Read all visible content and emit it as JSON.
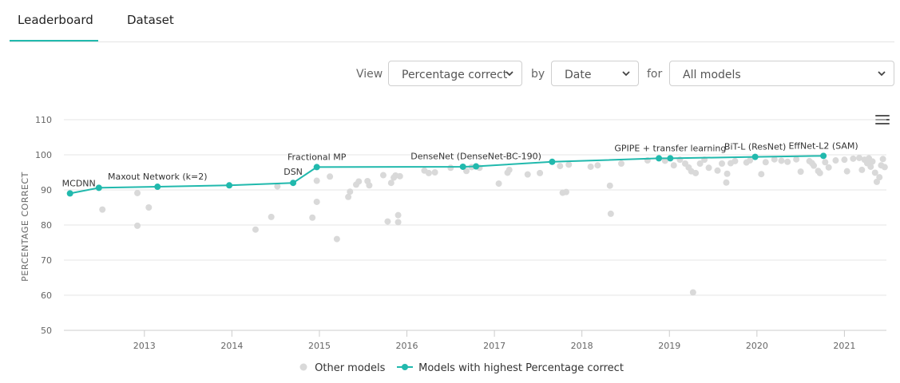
{
  "tabs": [
    {
      "label": "Leaderboard",
      "active": true
    },
    {
      "label": "Dataset",
      "active": false
    }
  ],
  "controls": {
    "view_label": "View",
    "metric_value": "Percentage correct",
    "by_label": "by",
    "axis_value": "Date",
    "for_label": "for",
    "filter_value": "All models"
  },
  "colors": {
    "accent": "#21b9ad",
    "other_models": "#d9d9d9",
    "grid": "#e6e6e6"
  },
  "icons": {
    "menu": "hamburger-menu-icon",
    "dropdown": "chevron-down-icon"
  },
  "legend": {
    "other": "Other models",
    "best": "Models with highest Percentage correct"
  },
  "chart_data": {
    "type": "scatter",
    "ylabel": "PERCENTAGE CORRECT",
    "xlabel": "",
    "ylim": [
      50,
      110
    ],
    "yticks": [
      50,
      60,
      70,
      80,
      90,
      100,
      110
    ],
    "xlim": [
      2012.08,
      2021.48
    ],
    "xticks": [
      "2013",
      "2014",
      "2015",
      "2016",
      "2017",
      "2018",
      "2019",
      "2020",
      "2021"
    ],
    "grid": "horizontal",
    "legend_position": "bottom",
    "series": [
      {
        "name": "Models with highest Percentage correct",
        "type": "line",
        "points": [
          {
            "x": 2012.15,
            "y": 89.0,
            "label": "MCDNN"
          },
          {
            "x": 2012.48,
            "y": 90.6,
            "label": ""
          },
          {
            "x": 2013.15,
            "y": 90.9,
            "label": "Maxout Network (k=2)"
          },
          {
            "x": 2013.97,
            "y": 91.3,
            "label": ""
          },
          {
            "x": 2014.7,
            "y": 92.0,
            "label": "DSN"
          },
          {
            "x": 2014.97,
            "y": 96.5,
            "label": "Fractional MP"
          },
          {
            "x": 2016.64,
            "y": 96.6,
            "label": ""
          },
          {
            "x": 2016.79,
            "y": 96.7,
            "label": "DenseNet (DenseNet-BC-190)"
          },
          {
            "x": 2017.66,
            "y": 98.0,
            "label": ""
          },
          {
            "x": 2018.88,
            "y": 99.0,
            "label": ""
          },
          {
            "x": 2019.01,
            "y": 99.0,
            "label": "GPIPE + transfer learning"
          },
          {
            "x": 2019.98,
            "y": 99.4,
            "label": "BiT-L (ResNet)"
          },
          {
            "x": 2020.76,
            "y": 99.7,
            "label": "EffNet-L2 (SAM)"
          }
        ]
      },
      {
        "name": "Other models",
        "type": "scatter",
        "points": [
          [
            2012.52,
            84.4
          ],
          [
            2012.92,
            89.1
          ],
          [
            2012.92,
            79.8
          ],
          [
            2013.05,
            85.0
          ],
          [
            2014.27,
            78.7
          ],
          [
            2014.45,
            82.3
          ],
          [
            2014.52,
            91.0
          ],
          [
            2014.92,
            82.1
          ],
          [
            2014.97,
            86.6
          ],
          [
            2014.97,
            92.6
          ],
          [
            2015.12,
            93.8
          ],
          [
            2015.2,
            76.0
          ],
          [
            2015.33,
            88.0
          ],
          [
            2015.35,
            89.5
          ],
          [
            2015.42,
            91.5
          ],
          [
            2015.45,
            92.4
          ],
          [
            2015.55,
            92.5
          ],
          [
            2015.57,
            91.3
          ],
          [
            2015.73,
            94.2
          ],
          [
            2015.78,
            81.0
          ],
          [
            2015.82,
            92.0
          ],
          [
            2015.85,
            93.5
          ],
          [
            2015.87,
            94.1
          ],
          [
            2015.9,
            82.8
          ],
          [
            2015.9,
            80.8
          ],
          [
            2015.92,
            93.9
          ],
          [
            2016.2,
            95.5
          ],
          [
            2016.25,
            94.8
          ],
          [
            2016.32,
            95.0
          ],
          [
            2016.5,
            96.3
          ],
          [
            2016.68,
            95.4
          ],
          [
            2016.74,
            96.5
          ],
          [
            2016.83,
            96.3
          ],
          [
            2017.05,
            91.8
          ],
          [
            2017.15,
            94.9
          ],
          [
            2017.17,
            95.7
          ],
          [
            2017.38,
            94.4
          ],
          [
            2017.52,
            94.8
          ],
          [
            2017.75,
            96.8
          ],
          [
            2017.78,
            89.2
          ],
          [
            2017.82,
            89.4
          ],
          [
            2017.85,
            97.2
          ],
          [
            2018.1,
            96.6
          ],
          [
            2018.18,
            97.0
          ],
          [
            2018.32,
            91.2
          ],
          [
            2018.33,
            83.2
          ],
          [
            2018.45,
            97.5
          ],
          [
            2018.75,
            98.4
          ],
          [
            2018.95,
            98.3
          ],
          [
            2019.05,
            97.0
          ],
          [
            2019.12,
            98.6
          ],
          [
            2019.18,
            97.5
          ],
          [
            2019.22,
            96.4
          ],
          [
            2019.25,
            95.3
          ],
          [
            2019.27,
            60.8
          ],
          [
            2019.3,
            94.8
          ],
          [
            2019.35,
            97.5
          ],
          [
            2019.4,
            98.6
          ],
          [
            2019.45,
            96.3
          ],
          [
            2019.55,
            95.5
          ],
          [
            2019.6,
            97.5
          ],
          [
            2019.65,
            92.1
          ],
          [
            2019.66,
            94.6
          ],
          [
            2019.7,
            97.6
          ],
          [
            2019.75,
            98.2
          ],
          [
            2019.88,
            97.8
          ],
          [
            2019.92,
            98.4
          ],
          [
            2020.05,
            94.5
          ],
          [
            2020.1,
            97.9
          ],
          [
            2020.2,
            98.7
          ],
          [
            2020.28,
            98.3
          ],
          [
            2020.35,
            98.0
          ],
          [
            2020.45,
            98.7
          ],
          [
            2020.5,
            95.2
          ],
          [
            2020.6,
            98.2
          ],
          [
            2020.63,
            97.6
          ],
          [
            2020.65,
            96.9
          ],
          [
            2020.7,
            95.4
          ],
          [
            2020.72,
            94.8
          ],
          [
            2020.78,
            97.9
          ],
          [
            2020.82,
            96.4
          ],
          [
            2020.9,
            98.4
          ],
          [
            2021.0,
            98.6
          ],
          [
            2021.03,
            95.3
          ],
          [
            2021.1,
            98.9
          ],
          [
            2021.17,
            99.1
          ],
          [
            2021.2,
            95.7
          ],
          [
            2021.23,
            98.6
          ],
          [
            2021.26,
            97.6
          ],
          [
            2021.28,
            99.0
          ],
          [
            2021.3,
            96.6
          ],
          [
            2021.32,
            98.1
          ],
          [
            2021.35,
            94.9
          ],
          [
            2021.37,
            92.3
          ],
          [
            2021.4,
            93.6
          ],
          [
            2021.42,
            97.0
          ],
          [
            2021.44,
            98.8
          ],
          [
            2021.46,
            96.5
          ]
        ]
      }
    ]
  }
}
